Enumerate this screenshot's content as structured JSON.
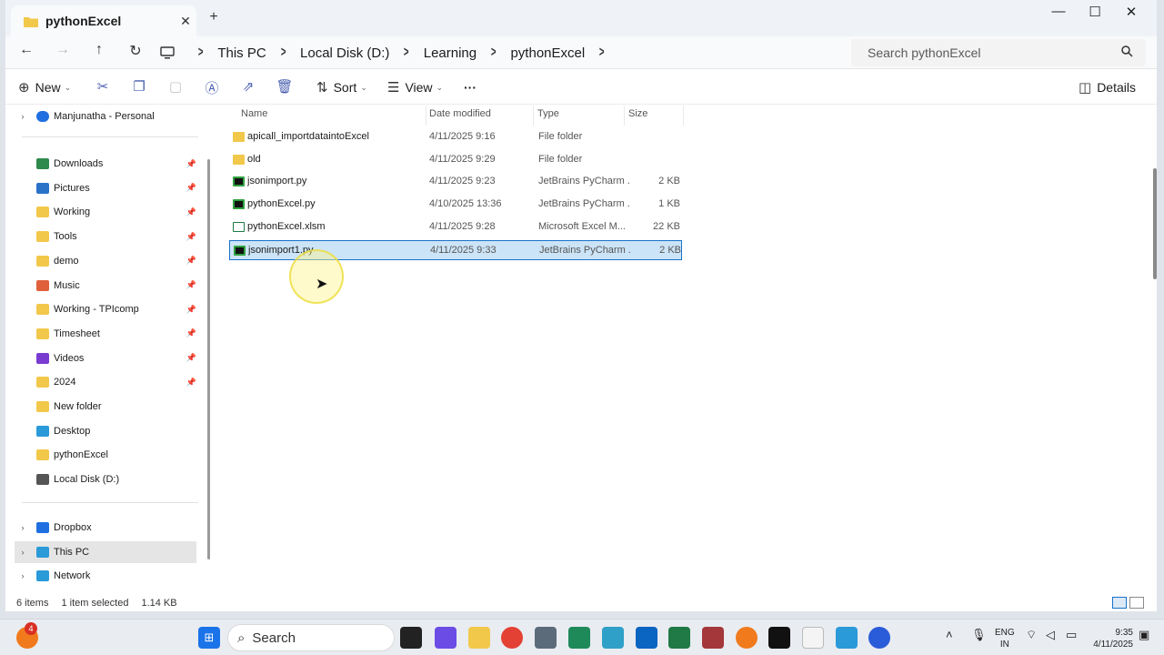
{
  "window": {
    "tab_title": "pythonExcel",
    "close_tab": "✕",
    "new_tab": "+",
    "minimize": "—",
    "maximize": "☐",
    "close": "✕"
  },
  "nav": {
    "back": "←",
    "forward": "→",
    "up": "↑",
    "refresh": "↻"
  },
  "breadcrumb": {
    "items": [
      "This PC",
      "Local Disk (D:)",
      "Learning",
      "pythonExcel"
    ],
    "separator": ">"
  },
  "search": {
    "placeholder": "Search pythonExcel",
    "icon": "search-icon"
  },
  "toolbar": {
    "new_label": "New",
    "sort_label": "Sort",
    "view_label": "View",
    "more_label": "···",
    "details_label": "Details"
  },
  "sidebar": {
    "account": "Manjunatha - Personal",
    "quick": [
      {
        "label": "Downloads",
        "pinned": true,
        "color": "#2f8a4e"
      },
      {
        "label": "Pictures",
        "pinned": true,
        "color": "#2a72c8"
      },
      {
        "label": "Working",
        "pinned": true,
        "color": "#f2c84b"
      },
      {
        "label": "Tools",
        "pinned": true,
        "color": "#f2c84b"
      },
      {
        "label": "demo",
        "pinned": true,
        "color": "#f2c84b"
      },
      {
        "label": "Music",
        "pinned": true,
        "color": "#e0603c"
      },
      {
        "label": "Working - TPIcomp",
        "pinned": true,
        "color": "#f2c84b"
      },
      {
        "label": "Timesheet",
        "pinned": true,
        "color": "#f2c84b"
      },
      {
        "label": "Videos",
        "pinned": true,
        "color": "#7a3bd0"
      },
      {
        "label": "2024",
        "pinned": true,
        "color": "#f2c84b"
      },
      {
        "label": "New folder",
        "pinned": false,
        "color": "#f2c84b"
      },
      {
        "label": "Desktop",
        "pinned": false,
        "color": "#2a9ad8"
      },
      {
        "label": "pythonExcel",
        "pinned": false,
        "color": "#f2c84b"
      },
      {
        "label": "Local Disk (D:)",
        "pinned": false,
        "color": "#555555"
      }
    ],
    "bottom": [
      {
        "label": "Dropbox",
        "color": "#1f6fe0"
      },
      {
        "label": "This PC",
        "color": "#2a9ad8"
      },
      {
        "label": "Network",
        "color": "#2a9ad8"
      }
    ]
  },
  "columns": [
    "Name",
    "Date modified",
    "Type",
    "Size"
  ],
  "files": [
    {
      "name": "apicall_importdataintoExcel",
      "date": "4/11/2025 9:16",
      "type": "File folder",
      "size": "",
      "kind": "folder"
    },
    {
      "name": "old",
      "date": "4/11/2025 9:29",
      "type": "File folder",
      "size": "",
      "kind": "folder"
    },
    {
      "name": "jsonimport.py",
      "date": "4/11/2025 9:23",
      "type": "JetBrains PyCharm ...",
      "size": "2 KB",
      "kind": "py"
    },
    {
      "name": "pythonExcel.py",
      "date": "4/10/2025 13:36",
      "type": "JetBrains PyCharm ...",
      "size": "1 KB",
      "kind": "py"
    },
    {
      "name": "pythonExcel.xlsm",
      "date": "4/11/2025 9:28",
      "type": "Microsoft Excel M...",
      "size": "22 KB",
      "kind": "xl"
    },
    {
      "name": "jsonimport1.py",
      "date": "4/11/2025 9:33",
      "type": "JetBrains PyCharm ...",
      "size": "2 KB",
      "kind": "py",
      "selected": true
    }
  ],
  "status": {
    "items": "6 items",
    "selected": "1 item selected",
    "size": "1.14 KB"
  },
  "taskbar": {
    "search_label": "Search",
    "lang_top": "ENG",
    "lang_bottom": "IN",
    "time": "9:35",
    "date": "4/11/2025",
    "badge": "4"
  }
}
